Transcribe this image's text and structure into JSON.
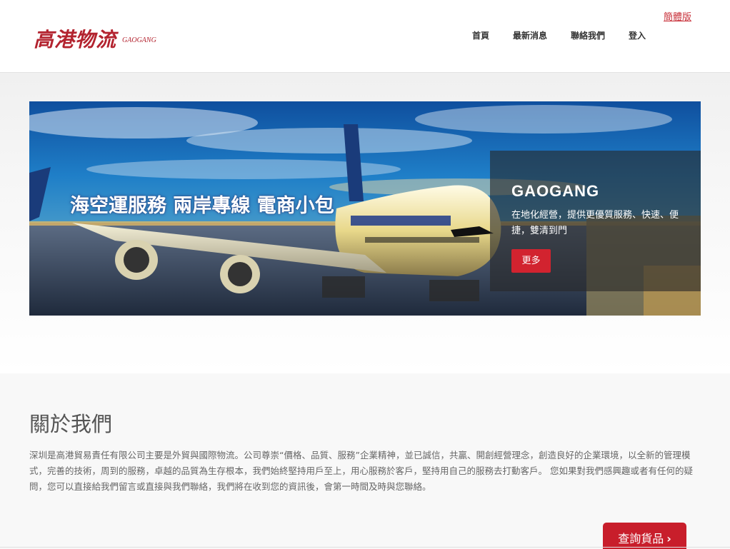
{
  "header": {
    "logo_cn": "高港物流",
    "logo_en": "GAOGANG",
    "lang_link": "簡體版",
    "nav": [
      {
        "label": "首頁"
      },
      {
        "label": "最新消息"
      },
      {
        "label": "聯絡我們"
      },
      {
        "label": "登入"
      }
    ]
  },
  "hero": {
    "banner_text": "海空運服務 兩岸專線 電商小包",
    "card": {
      "title": "GAOGANG",
      "description": "在地化經營，提供更優質服務、快速、便捷，雙清到門",
      "button": "更多"
    }
  },
  "about": {
    "title": "關於我們",
    "text": "深圳是高港貿易責任有限公司主要是外貿與國際物流。公司尊崇“價格、品質、服務”企業精神，並已誠信，共贏、開創經營理念，創造良好的企業環境，以全新的管理模式，完善的技術，周到的服務，卓越的品質為生存根本，我們始終堅持用戶至上，用心服務於客戶，堅持用自己的服務去打動客戶。 您如果對我們感興趣或者有任何的疑問，您可以直接給我們留言或直接與我們聯絡，我們將在收到您的資訊後，會第一時間及時與您聯絡。",
    "query_button": "查詢貨品",
    "query_chevron": "›"
  },
  "colors": {
    "brand_red": "#c81e2b",
    "logo_red": "#b3232f",
    "link_red": "#c8313a"
  },
  "icons": {
    "query_chevron": "chevron-right-icon"
  }
}
